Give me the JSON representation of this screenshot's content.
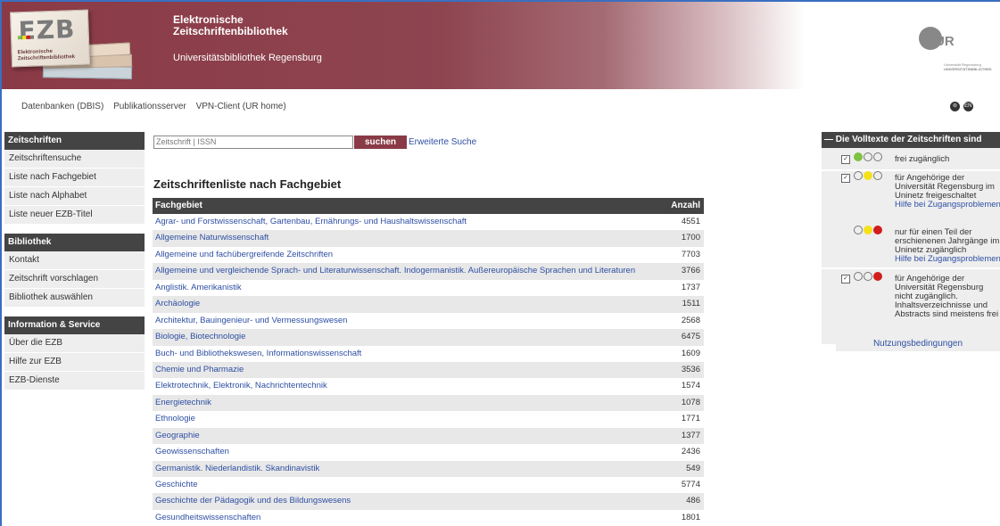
{
  "header": {
    "logo_text": "EZB",
    "logo_sub": "Elektronische Zeitschriftenbibliothek",
    "title_line1": "Elektronische",
    "title_line2": "Zeitschriftenbibliothek",
    "subtitle": "Universitätsbibliothek Regensburg",
    "ur_logo_text": "UR",
    "ur_caption_line1": "Universität Regensburg",
    "ur_caption_line2": "UNIVERSITÄTSBIBLIOTHEK"
  },
  "topnav": {
    "items": [
      "Datenbanken (DBIS)",
      "Publikationsserver",
      "VPN-Client (UR home)"
    ],
    "lang_en": "EN"
  },
  "sidebar": {
    "sections": [
      {
        "title": "Zeitschriften",
        "items": [
          "Zeitschriftensuche",
          "Liste nach Fachgebiet",
          "Liste nach Alphabet",
          "Liste neuer EZB-Titel"
        ]
      },
      {
        "title": "Bibliothek",
        "items": [
          "Kontakt",
          "Zeitschrift vorschlagen",
          "Bibliothek auswählen"
        ]
      },
      {
        "title": "Information & Service",
        "items": [
          "Über die EZB",
          "Hilfe zur EZB",
          "EZB-Dienste"
        ]
      }
    ]
  },
  "search": {
    "placeholder": "Zeitschrift | ISSN",
    "button": "suchen",
    "advanced": "Erweiterte Suche"
  },
  "list": {
    "title": "Zeitschriftenliste nach Fachgebiet",
    "col_subject": "Fachgebiet",
    "col_count": "Anzahl",
    "rows": [
      {
        "subject": "Agrar- und Forstwissenschaft, Gartenbau, Ernährungs- und Haushaltswissenschaft",
        "count": "4551"
      },
      {
        "subject": "Allgemeine Naturwissenschaft",
        "count": "1700"
      },
      {
        "subject": "Allgemeine und fachübergreifende Zeitschriften",
        "count": "7703"
      },
      {
        "subject": "Allgemeine und vergleichende Sprach- und Literaturwissenschaft. Indogermanistik. Außereuropäische Sprachen und Literaturen",
        "count": "3766"
      },
      {
        "subject": "Anglistik. Amerikanistik",
        "count": "1737"
      },
      {
        "subject": "Archäologie",
        "count": "1511"
      },
      {
        "subject": "Architektur, Bauingenieur- und Vermessungswesen",
        "count": "2568"
      },
      {
        "subject": "Biologie, Biotechnologie",
        "count": "6475"
      },
      {
        "subject": "Buch- und Bibliothekswesen, Informationswissenschaft",
        "count": "1609"
      },
      {
        "subject": "Chemie und Pharmazie",
        "count": "3536"
      },
      {
        "subject": "Elektrotechnik, Elektronik, Nachrichtentechnik",
        "count": "1574"
      },
      {
        "subject": "Energietechnik",
        "count": "1078"
      },
      {
        "subject": "Ethnologie",
        "count": "1771"
      },
      {
        "subject": "Geographie",
        "count": "1377"
      },
      {
        "subject": "Geowissenschaften",
        "count": "2436"
      },
      {
        "subject": "Germanistik. Niederlandistik. Skandinavistik",
        "count": "549"
      },
      {
        "subject": "Geschichte",
        "count": "5774"
      },
      {
        "subject": "Geschichte der Pädagogik und des Bildungswesens",
        "count": "486"
      },
      {
        "subject": "Gesundheitswissenschaften",
        "count": "1801"
      }
    ]
  },
  "legend": {
    "title": "Die Volltexte der Zeitschriften sind",
    "green_text": "frei zugänglich",
    "yellow_lines": [
      "für Angehörige der",
      "Universität Regensburg im",
      "Uninetz freigeschaltet"
    ],
    "yellow_help": "Hilfe bei Zugangsproblemen",
    "yellowred_lines": [
      "nur für einen Teil der",
      "erschienenen Jahrgänge im",
      "Uninetz zugänglich"
    ],
    "yellowred_help": "Hilfe bei Zugangsproblemen",
    "red_lines": [
      "für Angehörige der",
      "Universität Regensburg",
      "nicht zugänglich.",
      "Inhaltsverzeichnisse und",
      "Abstracts sind meistens frei"
    ],
    "terms": "Nutzungsbedingungen",
    "colors": {
      "green": "#7ec242",
      "yellow": "#f5e11a",
      "red": "#d21d1d"
    }
  }
}
